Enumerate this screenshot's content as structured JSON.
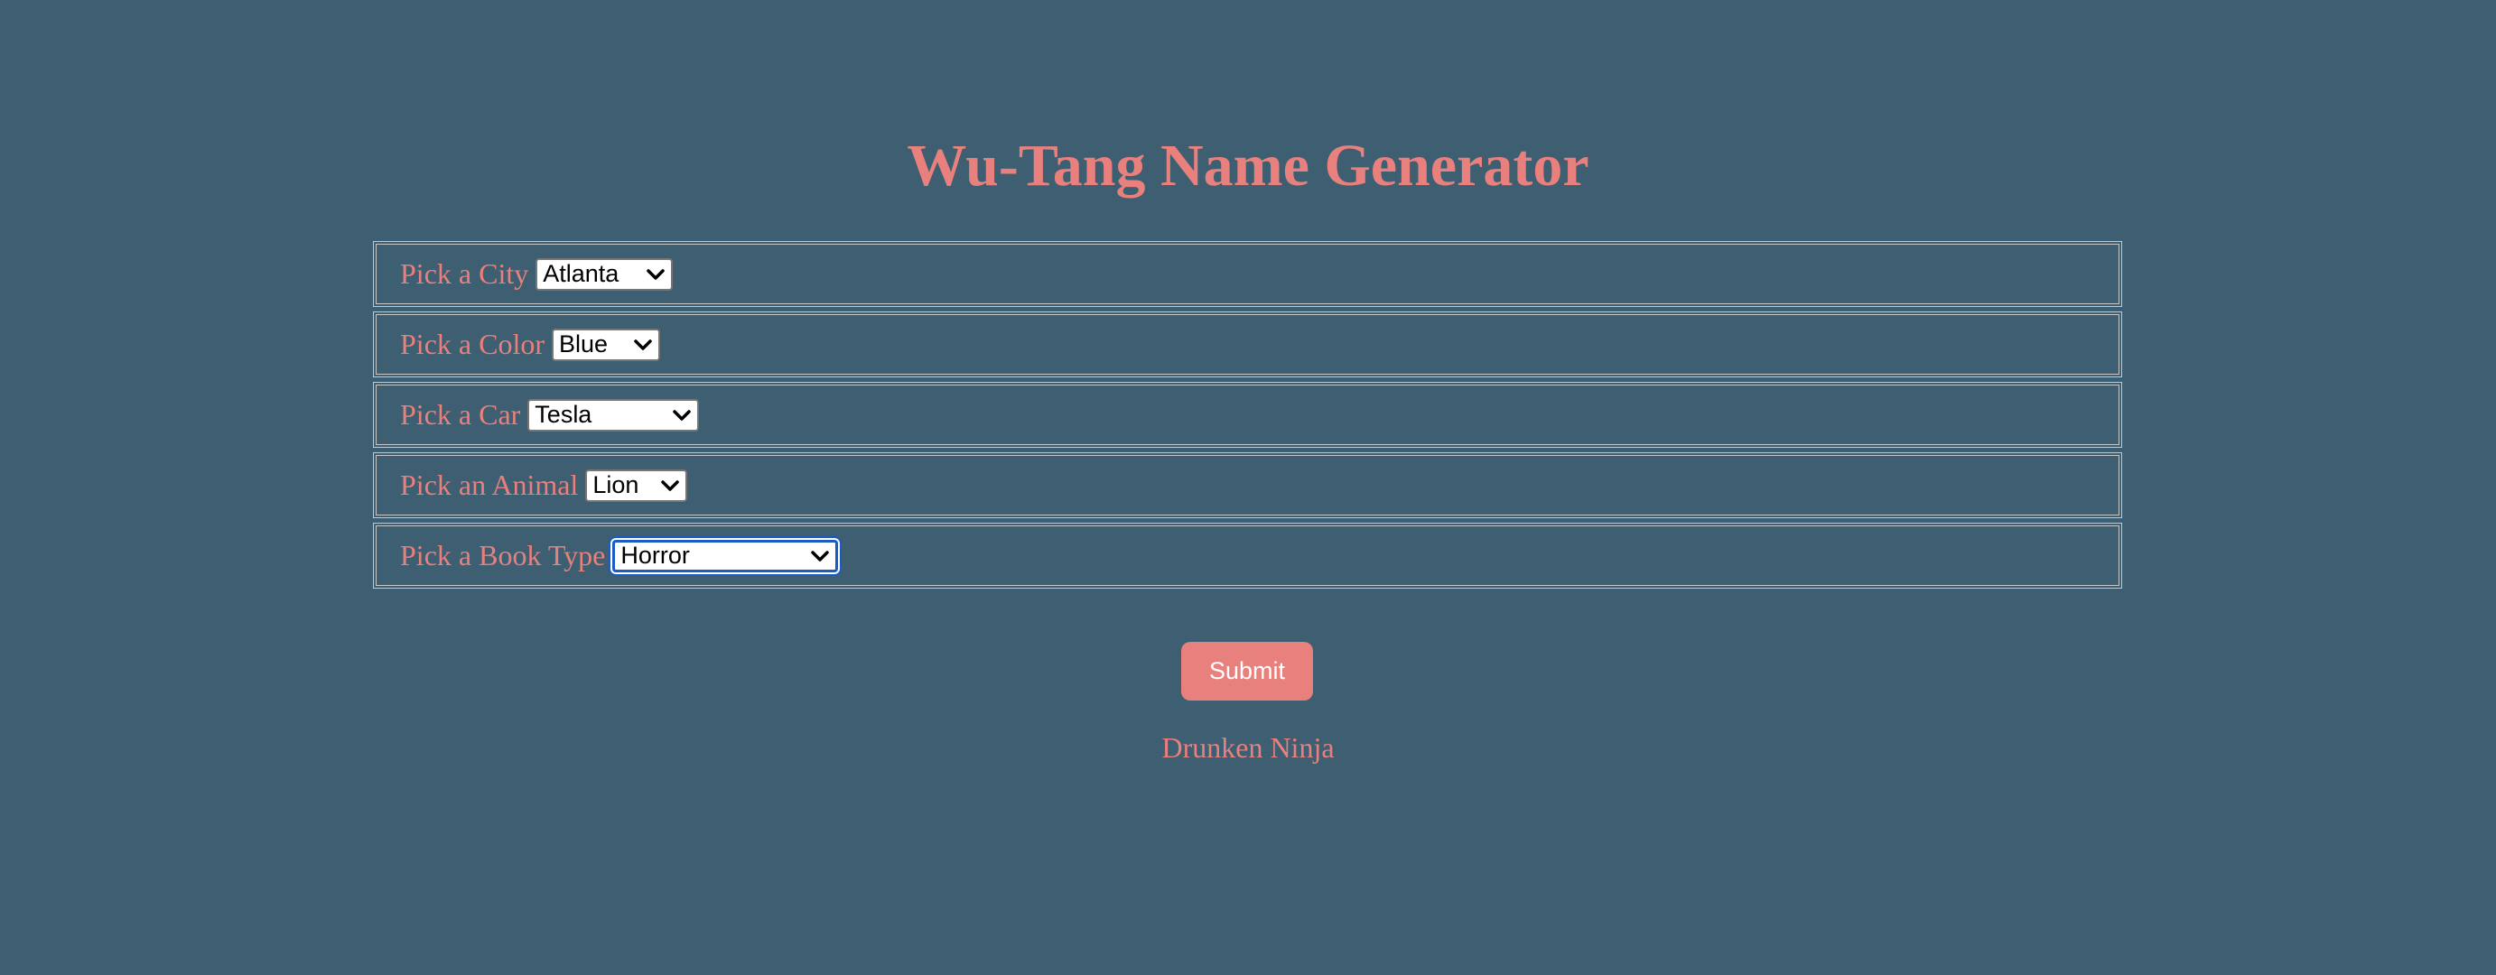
{
  "title": "Wu-Tang Name Generator",
  "form": {
    "city": {
      "label": "Pick a City",
      "selected": "Atlanta"
    },
    "color": {
      "label": "Pick a Color",
      "selected": "Blue"
    },
    "car": {
      "label": "Pick a Car",
      "selected": "Tesla"
    },
    "animal": {
      "label": "Pick an Animal",
      "selected": "Lion"
    },
    "book": {
      "label": "Pick a Book Type",
      "selected": "Horror"
    }
  },
  "submit_label": "Submit",
  "result_name": "Drunken Ninja",
  "icons": {
    "select_arrow": "chevron-down-icon"
  },
  "colors": {
    "background": "#3e5e71",
    "accent": "#e8807d",
    "focus_ring": "#1a5cc4",
    "row_border": "#c8c8c8"
  }
}
